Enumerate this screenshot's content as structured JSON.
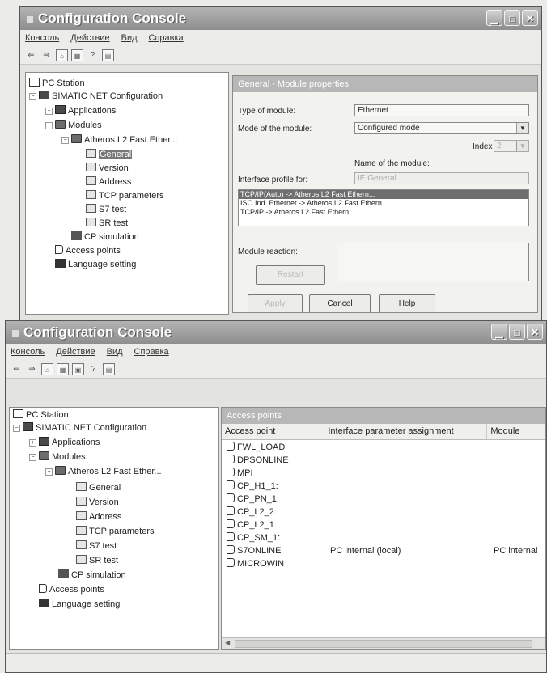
{
  "window_top": {
    "title": "Configuration Console",
    "menu": [
      "Консоль",
      "Действие",
      "Вид",
      "Справка"
    ],
    "tree": {
      "pc_station": "PC Station",
      "simatic": "SIMATIC NET Configuration",
      "applications": "Applications",
      "modules": "Modules",
      "atheros": "Atheros L2 Fast Ether...",
      "general": "General",
      "version": "Version",
      "address": "Address",
      "tcp": "TCP parameters",
      "s7test": "S7 test",
      "srtest": "SR test",
      "cpsim": "CP simulation",
      "access_points": "Access points",
      "language": "Language setting"
    },
    "panel": {
      "header": "General - Module properties",
      "type_label": "Type of module:",
      "type_value": "Ethernet",
      "mode_label": "Mode of the module:",
      "mode_value": "Configured mode",
      "index_label": "Index",
      "index_value": "2",
      "name_label": "Name of the module:",
      "profile_label": "Interface profile for:",
      "profile_value": "IE General",
      "profiles": [
        "TCP/IP(Auto) -> Atheros L2 Fast Ethern...",
        "ISO Ind. Ethernet -> Atheros L2 Fast Ethern...",
        "TCP/IP -> Atheros L2 Fast Ethern..."
      ],
      "reaction_label": "Module reaction:",
      "restart_label": "Restart",
      "apply_label": "Apply",
      "cancel_label": "Cancel",
      "help_label": "Help"
    }
  },
  "window_bottom": {
    "title": "Configuration Console",
    "menu": [
      "Консоль",
      "Действие",
      "Вид",
      "Справка"
    ],
    "tree": {
      "pc_station": "PC Station",
      "simatic": "SIMATIC NET Configuration",
      "applications": "Applications",
      "modules": "Modules",
      "atheros": "Atheros L2 Fast Ether...",
      "general": "General",
      "version": "Version",
      "address": "Address",
      "tcp": "TCP parameters",
      "s7test": "S7 test",
      "srtest": "SR test",
      "cpsim": "CP simulation",
      "access_points": "Access points",
      "language": "Language setting"
    },
    "panel": {
      "header": "Access points",
      "columns": [
        "Access point",
        "Interface parameter assignment",
        "Module"
      ],
      "rows": [
        {
          "ap": "FWL_LOAD",
          "assign": "",
          "module": ""
        },
        {
          "ap": "DPSONLINE",
          "assign": "",
          "module": ""
        },
        {
          "ap": "MPI",
          "assign": "",
          "module": ""
        },
        {
          "ap": "CP_H1_1:",
          "assign": "",
          "module": ""
        },
        {
          "ap": "CP_PN_1:",
          "assign": "",
          "module": ""
        },
        {
          "ap": "CP_L2_2:",
          "assign": "",
          "module": ""
        },
        {
          "ap": "CP_L2_1:",
          "assign": "",
          "module": ""
        },
        {
          "ap": "CP_SM_1:",
          "assign": "",
          "module": ""
        },
        {
          "ap": "S7ONLINE",
          "assign": "PC internal (local)",
          "module": "PC internal"
        },
        {
          "ap": "MICROWIN",
          "assign": "",
          "module": ""
        }
      ]
    }
  }
}
